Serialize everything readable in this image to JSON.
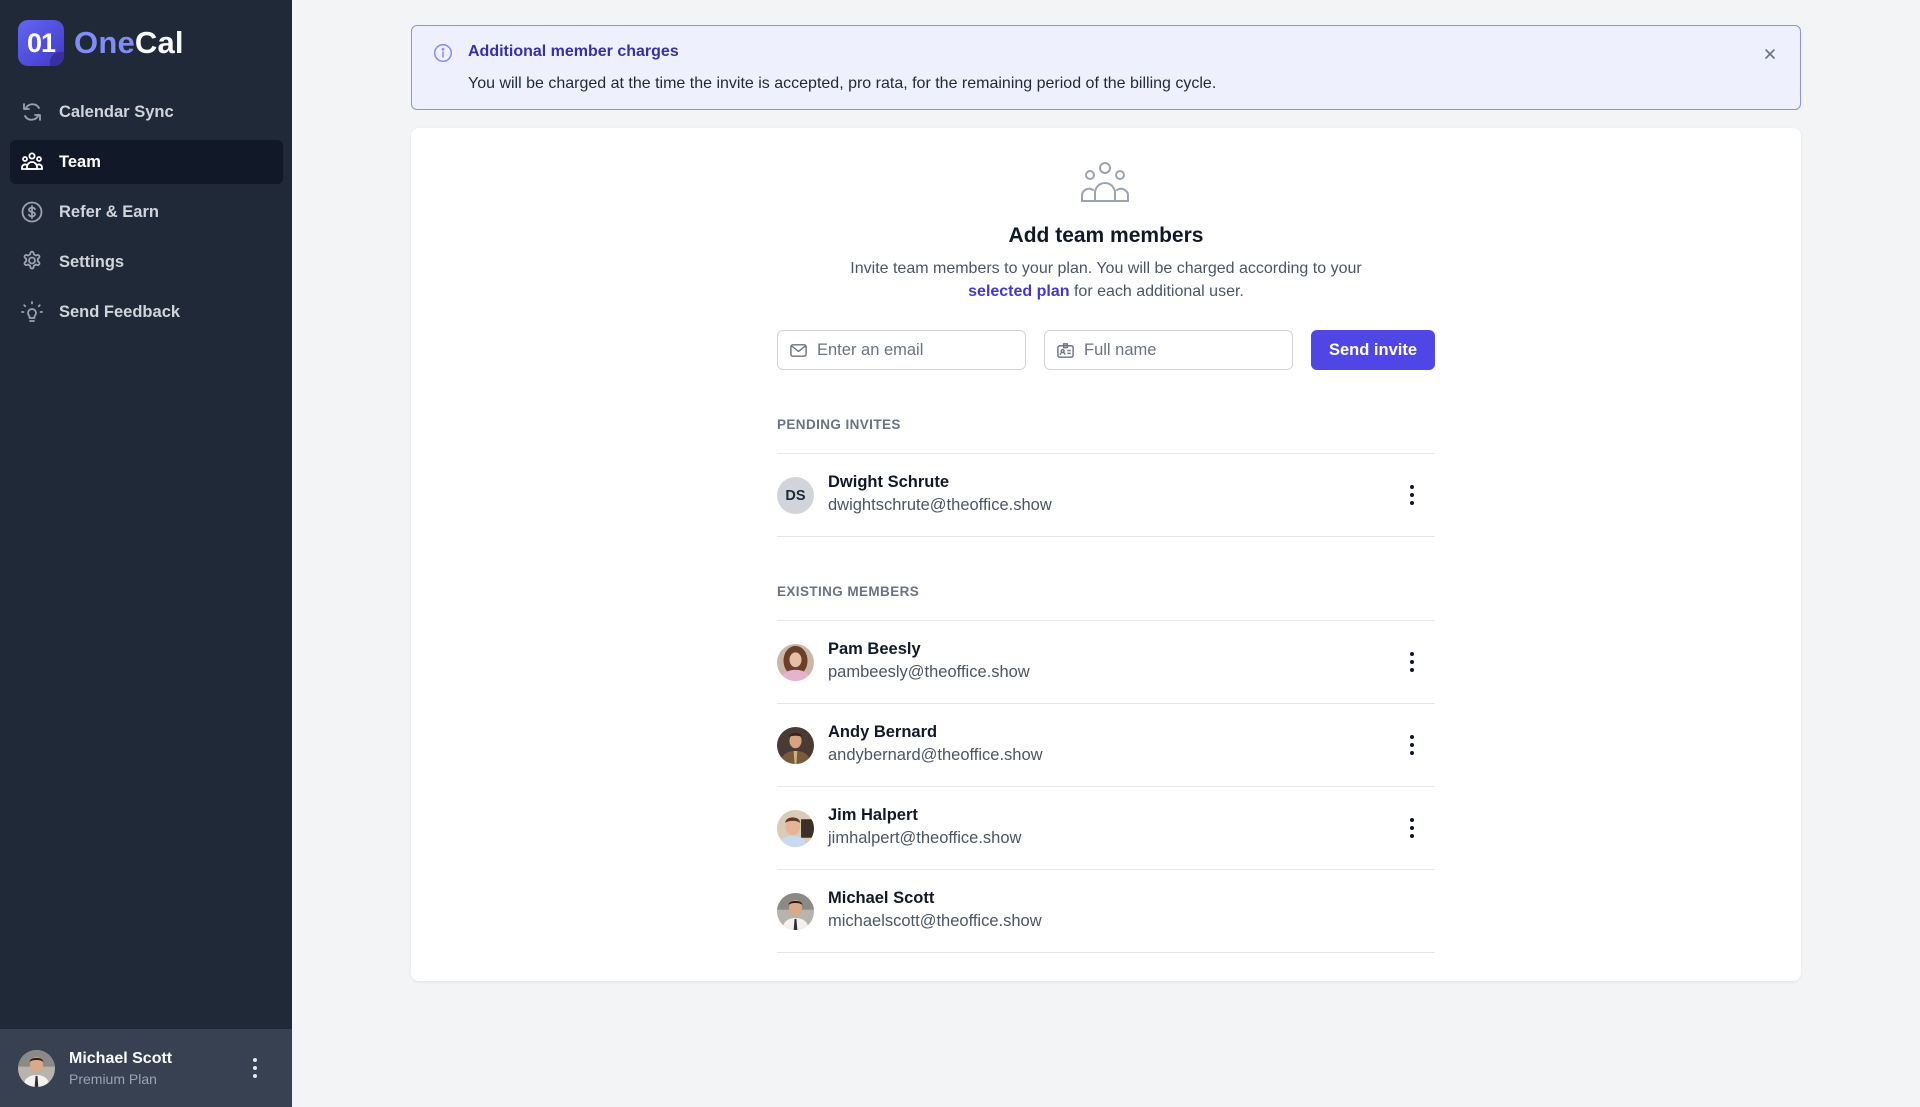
{
  "app": {
    "logo_mark": "01",
    "logo_text_primary": "One",
    "logo_text_secondary": "Cal",
    "accent_color": "#4f46e5"
  },
  "sidebar": {
    "items": [
      {
        "label": "Calendar Sync",
        "icon": "refresh-icon",
        "active": false
      },
      {
        "label": "Team",
        "icon": "users-icon",
        "active": true
      },
      {
        "label": "Refer & Earn",
        "icon": "dollar-icon",
        "active": false
      },
      {
        "label": "Settings",
        "icon": "gear-icon",
        "active": false
      },
      {
        "label": "Send Feedback",
        "icon": "lightbulb-icon",
        "active": false
      }
    ],
    "user": {
      "name": "Michael Scott",
      "plan": "Premium Plan"
    }
  },
  "banner": {
    "title": "Additional member charges",
    "text": "You will be charged at the time the invite is accepted, pro rata, for the remaining period of the billing cycle."
  },
  "card": {
    "title": "Add team members",
    "description_part1": "Invite team members to your plan. You will be charged according to your",
    "description_link": "selected plan",
    "description_part2": "for each additional user.",
    "email_input": {
      "placeholder": "Enter an email",
      "value": ""
    },
    "name_input": {
      "placeholder": "Full name",
      "value": ""
    },
    "send_button": "Send invite"
  },
  "pending": {
    "label": "PENDING INVITES",
    "items": [
      {
        "initials": "DS",
        "name": "Dwight Schrute",
        "email": "dwightschrute@theoffice.show"
      }
    ]
  },
  "members": {
    "label": "EXISTING MEMBERS",
    "items": [
      {
        "name": "Pam Beesly",
        "email": "pambeesly@theoffice.show",
        "has_menu": true
      },
      {
        "name": "Andy Bernard",
        "email": "andybernard@theoffice.show",
        "has_menu": true
      },
      {
        "name": "Jim Halpert",
        "email": "jimhalpert@theoffice.show",
        "has_menu": true
      },
      {
        "name": "Michael Scott",
        "email": "michaelscott@theoffice.show",
        "has_menu": false
      }
    ]
  }
}
